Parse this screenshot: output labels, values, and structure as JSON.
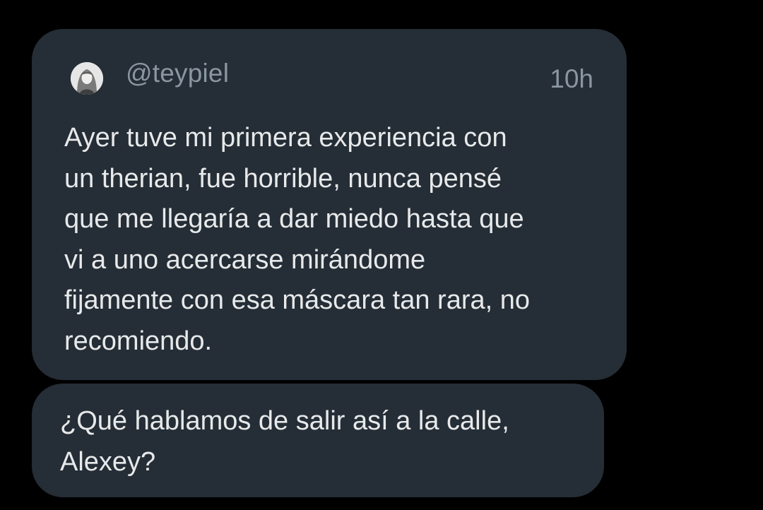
{
  "quoted_post": {
    "avatar_icon": "user-avatar-photo",
    "handle": "@teypiel",
    "time": "10h",
    "text": "Ayer tuve mi primera experiencia con\nun therian, fue horrible, nunca pensé\nque me llegaría a dar miedo hasta que\nvi a uno acercarse mirándome\nfijamente con esa máscara tan rara, no\nrecomiendo."
  },
  "reply": {
    "text": "¿Qué hablamos de salir así a la calle,\nAlexey?"
  },
  "colors": {
    "background": "#000000",
    "bubble": "#252d36",
    "text_primary": "#e7e9ea",
    "text_secondary": "#8a96a1"
  }
}
